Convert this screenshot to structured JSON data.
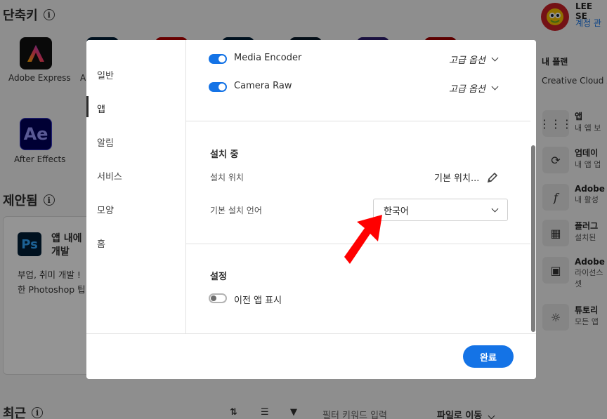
{
  "background": {
    "shortcuts_title": "단축키",
    "apps": [
      {
        "label": "Adobe Express",
        "icon": "adobe-express-icon"
      },
      {
        "label": "After Effects",
        "icon": "after-effects-icon",
        "tile_text": "Ae"
      }
    ],
    "suggested_title": "제안됨",
    "suggested_card": {
      "tile_text": "Ps",
      "title_line1": "앱 내에",
      "title_line2": "개발",
      "body_line1": "부업, 취미 개발 !",
      "body_line2": "한 Photoshop 팁"
    },
    "user": {
      "name": "LEE SE",
      "account_link": "계정 관"
    },
    "plan": {
      "title": "내 플랜",
      "subtitle": "Creative Cloud 모"
    },
    "right_items": [
      {
        "title": "앱",
        "sub": "내 앱 보",
        "icon": "grid-icon"
      },
      {
        "title": "업데이",
        "sub": "내 앱 업",
        "icon": "refresh-icon"
      },
      {
        "title": "Adobe",
        "sub": "내 활성",
        "icon": "font-icon"
      },
      {
        "title": "플러그",
        "sub": "설치된",
        "icon": "plugin-icon"
      },
      {
        "title": "Adobe",
        "sub": "라이선스",
        "sub2": "셋",
        "icon": "license-icon"
      },
      {
        "title": "튜토리",
        "sub": "모든 앱",
        "icon": "lightbulb-icon"
      }
    ],
    "recent_title": "최근",
    "filter_placeholder": "필터  키워드 입력",
    "goto_file": "파일로 이동"
  },
  "modal": {
    "sidebar": [
      {
        "label": "일반",
        "active": false
      },
      {
        "label": "앱",
        "active": true
      },
      {
        "label": "알림",
        "active": false
      },
      {
        "label": "서비스",
        "active": false
      },
      {
        "label": "모양",
        "active": false
      },
      {
        "label": "홈",
        "active": false
      }
    ],
    "apps_list": [
      {
        "name": "Media Encoder",
        "enabled": true,
        "advanced": "고급 옵션"
      },
      {
        "name": "Camera Raw",
        "enabled": true,
        "advanced": "고급 옵션"
      }
    ],
    "installing": {
      "heading": "설치 중",
      "location_label": "설치 위치",
      "location_value": "기본 위치...",
      "language_label": "기본 설치 언어",
      "language_value": "한국어"
    },
    "settings": {
      "heading": "설정",
      "show_old_apps_label": "이전 앱 표시",
      "show_old_apps": false
    },
    "done_label": "완료"
  },
  "colors": {
    "accent": "#1473e6",
    "annotation_arrow": "#ff0000"
  }
}
